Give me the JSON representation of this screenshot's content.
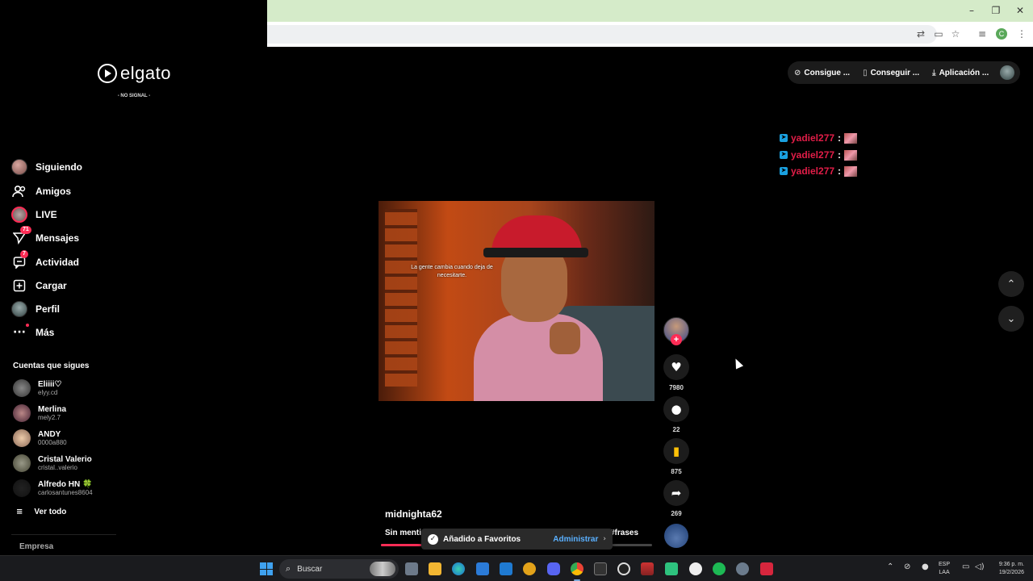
{
  "browser": {
    "window_controls": [
      "minimize-icon",
      "restore-icon",
      "close-icon"
    ],
    "toolbar_icons": [
      "translate-icon",
      "cast-icon",
      "bookmark-star-icon",
      "media-controls-icon",
      "profile-icon",
      "menu-icon"
    ],
    "profile_letter": "C"
  },
  "overlay": {
    "brand": "elgato",
    "status": "- NO SIGNAL -"
  },
  "sidebar": {
    "nav": [
      {
        "label": "Siguiendo",
        "icon": "avatar"
      },
      {
        "label": "Amigos",
        "icon": "friends-icon"
      },
      {
        "label": "LIVE",
        "icon": "live-avatar"
      },
      {
        "label": "Mensajes",
        "icon": "messages-icon",
        "badge": "71"
      },
      {
        "label": "Actividad",
        "icon": "activity-icon",
        "badge": "7"
      },
      {
        "label": "Cargar",
        "icon": "upload-icon"
      },
      {
        "label": "Perfil",
        "icon": "profile-avatar"
      },
      {
        "label": "Más",
        "icon": "more-icon"
      }
    ],
    "following_title": "Cuentas que sigues",
    "accounts": [
      {
        "name": "Eliiii♡",
        "handle": "elyy.cd"
      },
      {
        "name": "Merlina",
        "handle": "mely2.7"
      },
      {
        "name": "ANDY",
        "handle": "0000a880"
      },
      {
        "name": "Cristal Valerio",
        "handle": "cristal..valerio"
      },
      {
        "name": "Alfredo HN 🍀",
        "handle": "carlosantunes8604"
      }
    ],
    "see_all": "Ver todo",
    "company": "Empresa"
  },
  "top_actions": {
    "coins": "Consigue ...",
    "app": "Conseguir ...",
    "download": "Aplicación ..."
  },
  "chat": [
    {
      "user": "yadiel277",
      "sep": ":"
    },
    {
      "user": "yadiel277",
      "sep": ":"
    },
    {
      "user": "yadiel277",
      "sep": ":"
    }
  ],
  "video": {
    "subtitle": "La gente cambia cuando deja de necesitarte.",
    "author": "midnighta62",
    "caption_start": "Sin mentir",
    "caption_tag": "#frases",
    "progress": 0.15,
    "stats": {
      "likes": "7980",
      "comments": "22",
      "saves": "875",
      "shares": "269"
    }
  },
  "toast": {
    "message": "Añadido a Favoritos",
    "action": "Administrar"
  },
  "taskbar": {
    "search_placeholder": "Buscar",
    "lang_top": "ESP",
    "lang_bottom": "LAA",
    "time": "9:36 p. m.",
    "date": "19/2/2026"
  }
}
